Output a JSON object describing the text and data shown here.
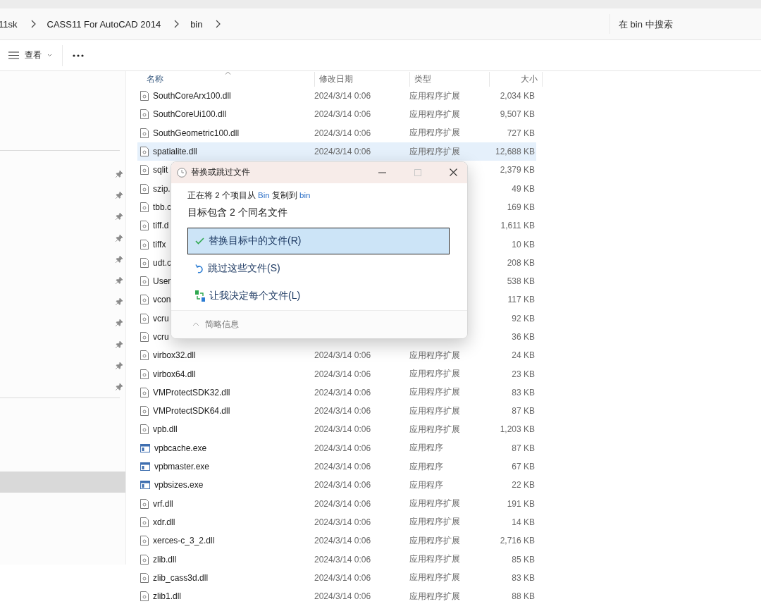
{
  "breadcrumb": [
    "11sk",
    "CASS11 For AutoCAD 2014",
    "bin"
  ],
  "search": {
    "placeholder": "在 bin 中搜索"
  },
  "toolbar": {
    "view_label": "查看"
  },
  "sidebar": {
    "pins": [
      {
        "pinned": true
      },
      {
        "pinned": true
      },
      {
        "pinned": true
      },
      {
        "pinned": true
      },
      {
        "pinned": true
      },
      {
        "pinned": true
      },
      {
        "pinned": true
      },
      {
        "pinned": true
      },
      {
        "pinned": true
      },
      {
        "pinned": true
      },
      {
        "pinned": true
      }
    ],
    "items": [
      {
        "selected": true
      }
    ]
  },
  "columns": [
    "名称",
    "修改日期",
    "类型",
    "大小"
  ],
  "files": [
    {
      "kind": "dll",
      "name": "SouthCoreArx100.dll",
      "date": "2024/3/14 0:06",
      "type": "应用程序扩展",
      "size": "2,034 KB",
      "selected": false
    },
    {
      "kind": "dll",
      "name": "SouthCoreUi100.dll",
      "date": "2024/3/14 0:06",
      "type": "应用程序扩展",
      "size": "9,507 KB",
      "selected": false
    },
    {
      "kind": "dll",
      "name": "SouthGeometric100.dll",
      "date": "2024/3/14 0:06",
      "type": "应用程序扩展",
      "size": "727 KB",
      "selected": false
    },
    {
      "kind": "dll",
      "name": "spatialite.dll",
      "date": "2024/3/14 0:06",
      "type": "应用程序扩展",
      "size": "12,688 KB",
      "selected": true
    },
    {
      "kind": "dll",
      "name": "sqlit",
      "size": "2,379 KB",
      "selected": false
    },
    {
      "kind": "dll",
      "name": "szip.",
      "size": "49 KB",
      "selected": false
    },
    {
      "kind": "dll",
      "name": "tbb.c",
      "size": "169 KB",
      "selected": false
    },
    {
      "kind": "dll",
      "name": "tiff.d",
      "size": "1,611 KB",
      "selected": false
    },
    {
      "kind": "dll",
      "name": "tiffx",
      "size": "10 KB",
      "selected": false
    },
    {
      "kind": "dll",
      "name": "udt.c",
      "size": "208 KB",
      "selected": false
    },
    {
      "kind": "dll",
      "name": "User",
      "size": "538 KB",
      "selected": false
    },
    {
      "kind": "dll",
      "name": "vcon",
      "size": "117 KB",
      "selected": false
    },
    {
      "kind": "dll",
      "name": "vcru",
      "size": "92 KB",
      "selected": false
    },
    {
      "kind": "dll",
      "name": "vcru",
      "size": "36 KB",
      "selected": false
    },
    {
      "kind": "dll",
      "name": "virbox32.dll",
      "date": "2024/3/14 0:06",
      "type": "应用程序扩展",
      "size": "24 KB",
      "selected": false
    },
    {
      "kind": "dll",
      "name": "virbox64.dll",
      "date": "2024/3/14 0:06",
      "type": "应用程序扩展",
      "size": "23 KB",
      "selected": false
    },
    {
      "kind": "dll",
      "name": "VMProtectSDK32.dll",
      "date": "2024/3/14 0:06",
      "type": "应用程序扩展",
      "size": "83 KB",
      "selected": false
    },
    {
      "kind": "dll",
      "name": "VMProtectSDK64.dll",
      "date": "2024/3/14 0:06",
      "type": "应用程序扩展",
      "size": "87 KB",
      "selected": false
    },
    {
      "kind": "dll",
      "name": "vpb.dll",
      "date": "2024/3/14 0:06",
      "type": "应用程序扩展",
      "size": "1,203 KB",
      "selected": false
    },
    {
      "kind": "exe",
      "name": "vpbcache.exe",
      "date": "2024/3/14 0:06",
      "type": "应用程序",
      "size": "87 KB",
      "selected": false
    },
    {
      "kind": "exe",
      "name": "vpbmaster.exe",
      "date": "2024/3/14 0:06",
      "type": "应用程序",
      "size": "67 KB",
      "selected": false
    },
    {
      "kind": "exe",
      "name": "vpbsizes.exe",
      "date": "2024/3/14 0:06",
      "type": "应用程序",
      "size": "22 KB",
      "selected": false
    },
    {
      "kind": "dll",
      "name": "vrf.dll",
      "date": "2024/3/14 0:06",
      "type": "应用程序扩展",
      "size": "191 KB",
      "selected": false
    },
    {
      "kind": "dll",
      "name": "xdr.dll",
      "date": "2024/3/14 0:06",
      "type": "应用程序扩展",
      "size": "14 KB",
      "selected": false
    },
    {
      "kind": "dll",
      "name": "xerces-c_3_2.dll",
      "date": "2024/3/14 0:06",
      "type": "应用程序扩展",
      "size": "2,716 KB",
      "selected": false
    },
    {
      "kind": "dll",
      "name": "zlib.dll",
      "date": "2024/3/14 0:06",
      "type": "应用程序扩展",
      "size": "85 KB",
      "selected": false
    },
    {
      "kind": "dll",
      "name": "zlib_cass3d.dll",
      "date": "2024/3/14 0:06",
      "type": "应用程序扩展",
      "size": "83 KB",
      "selected": false
    },
    {
      "kind": "dll",
      "name": "zlib1.dll",
      "date": "2024/3/14 0:06",
      "type": "应用程序扩展",
      "size": "88 KB",
      "selected": false
    }
  ],
  "dialog": {
    "title": "替换或跳过文件",
    "copy_line": [
      {
        "kind": "text",
        "text": "正在将 2 个项目从 "
      },
      {
        "kind": "link",
        "text": "Bin"
      },
      {
        "kind": "text",
        "text": " 复制到 "
      },
      {
        "kind": "link",
        "text": "bin"
      }
    ],
    "heading": "目标包含 2 个同名文件",
    "options": [
      {
        "kind": "replace",
        "label": "替换目标中的文件(R)",
        "selected": true
      },
      {
        "kind": "skip",
        "label": "跳过这些文件(S)",
        "selected": false
      },
      {
        "kind": "decide",
        "label": "让我决定每个文件(L)",
        "selected": false
      }
    ],
    "details": "简略信息"
  }
}
